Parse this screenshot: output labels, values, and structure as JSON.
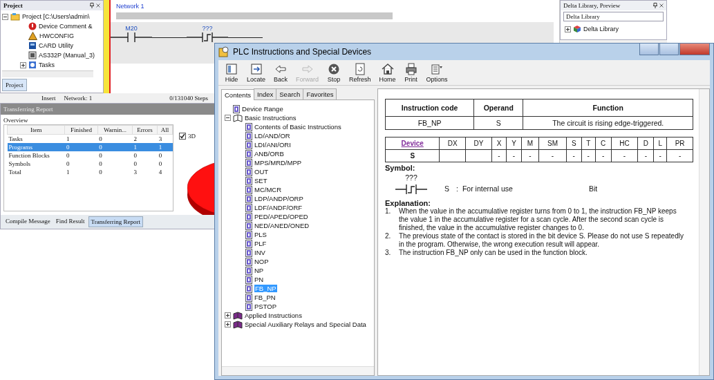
{
  "ide": {
    "project_panel": {
      "title": "Project",
      "tree": [
        {
          "label": "Project [C:\\Users\\admin\\",
          "kind": "project",
          "expanded": true,
          "children": [
            {
              "label": "Device Comment &",
              "kind": "comment"
            },
            {
              "label": "HWCONFIG",
              "kind": "config"
            },
            {
              "label": "CARD Utility",
              "kind": "card"
            },
            {
              "label": "AS332P  (Manual_3)",
              "kind": "cpu"
            },
            {
              "label": "Tasks",
              "kind": "tasks",
              "expanded": false
            }
          ]
        }
      ],
      "tab": "Project"
    },
    "ladder": {
      "network": "Network 1",
      "contacts": [
        {
          "kind": "normally-open",
          "label": "M20"
        },
        {
          "kind": "rising-edge",
          "label": "???"
        }
      ]
    },
    "library": {
      "title": "Delta Library, Preview",
      "dropdown": "Delta Library",
      "tree": [
        {
          "label": "Delta Library",
          "expanded": false
        }
      ]
    },
    "status_bar": [
      "Insert",
      "Network: 1",
      "0/131040 Steps"
    ],
    "report": {
      "title": "Transferring Report",
      "section": "Overview",
      "columns": [
        "Item",
        "Finished",
        "Warnin...",
        "Errors",
        "All"
      ],
      "rows": [
        {
          "cells": [
            "Tasks",
            "1",
            "0",
            "2",
            "3"
          ],
          "selected": false
        },
        {
          "cells": [
            "Programs",
            "0",
            "0",
            "1",
            "1"
          ],
          "selected": true
        },
        {
          "cells": [
            "Function Blocks",
            "0",
            "0",
            "0",
            "0"
          ],
          "selected": false
        },
        {
          "cells": [
            "Symbols",
            "0",
            "0",
            "0",
            "0"
          ],
          "selected": false
        },
        {
          "cells": [
            "Total",
            "1",
            "0",
            "3",
            "4"
          ],
          "selected": false
        }
      ],
      "checkbox": {
        "label": "3D",
        "checked": true
      },
      "tabs": [
        {
          "label": "Compile Message",
          "selected": false
        },
        {
          "label": "Find Result",
          "selected": false
        },
        {
          "label": "Transferring Report",
          "selected": true
        }
      ]
    }
  },
  "dialog": {
    "title": "PLC Instructions and Special Devices",
    "toolbar": [
      {
        "label": "Hide",
        "disabled": false
      },
      {
        "label": "Locate",
        "disabled": false
      },
      {
        "label": "Back",
        "disabled": false
      },
      {
        "label": "Forward",
        "disabled": true
      },
      {
        "label": "Stop",
        "disabled": false
      },
      {
        "label": "Refresh",
        "disabled": false
      },
      {
        "label": "Home",
        "disabled": false
      },
      {
        "label": "Print",
        "disabled": false
      },
      {
        "label": "Options",
        "disabled": false
      }
    ],
    "nav_tabs": [
      {
        "label": "Contents",
        "selected": true
      },
      {
        "label": "Index",
        "selected": false
      },
      {
        "label": "Search",
        "selected": false
      },
      {
        "label": "Favorites",
        "selected": false
      }
    ],
    "tree": [
      {
        "label": "Device Range",
        "kind": "page",
        "selected": false
      },
      {
        "label": "Basic Instructions",
        "kind": "book",
        "expanded": true,
        "selected": false,
        "children": [
          {
            "label": "Contents of Basic Instructions",
            "kind": "page",
            "selected": false
          },
          {
            "label": "LD/AND/OR",
            "kind": "page",
            "selected": false
          },
          {
            "label": "LDI/ANI/ORI",
            "kind": "page",
            "selected": false
          },
          {
            "label": "ANB/ORB",
            "kind": "page",
            "selected": false
          },
          {
            "label": "MPS/MRD/MPP",
            "kind": "page",
            "selected": false
          },
          {
            "label": "OUT",
            "kind": "page",
            "selected": false
          },
          {
            "label": "SET",
            "kind": "page",
            "selected": false
          },
          {
            "label": "MC/MCR",
            "kind": "page",
            "selected": false
          },
          {
            "label": "LDP/ANDP/ORP",
            "kind": "page",
            "selected": false
          },
          {
            "label": "LDF/ANDF/ORF",
            "kind": "page",
            "selected": false
          },
          {
            "label": "PED/APED/OPED",
            "kind": "page",
            "selected": false
          },
          {
            "label": "NED/ANED/ONED",
            "kind": "page",
            "selected": false
          },
          {
            "label": "PLS",
            "kind": "page",
            "selected": false
          },
          {
            "label": "PLF",
            "kind": "page",
            "selected": false
          },
          {
            "label": "INV",
            "kind": "page",
            "selected": false
          },
          {
            "label": "NOP",
            "kind": "page",
            "selected": false
          },
          {
            "label": "NP",
            "kind": "page",
            "selected": false
          },
          {
            "label": "PN",
            "kind": "page",
            "selected": false
          },
          {
            "label": "FB_NP",
            "kind": "page",
            "selected": true
          },
          {
            "label": "FB_PN",
            "kind": "page",
            "selected": false
          },
          {
            "label": "PSTOP",
            "kind": "page",
            "selected": false
          }
        ]
      },
      {
        "label": "Applied Instructions",
        "kind": "book",
        "expanded": false,
        "selected": false
      },
      {
        "label": "Special Auxiliary Relays and Special Data",
        "kind": "book",
        "expanded": false,
        "selected": false
      }
    ],
    "content": {
      "instruction_table": {
        "columns": [
          "Instruction code",
          "Operand",
          "Function"
        ],
        "row": [
          "FB_NP",
          "S",
          "The circuit is rising edge-triggered."
        ]
      },
      "device_table": [
        {
          "header": "Device",
          "value": "S"
        },
        {
          "header": "DX"
        },
        {
          "header": "DY"
        },
        {
          "header": "X",
          "value": "-"
        },
        {
          "header": "Y",
          "value": "-"
        },
        {
          "header": "M",
          "value": "-"
        },
        {
          "header": "SM",
          "value": "-"
        },
        {
          "header": "S",
          "value": "-"
        },
        {
          "header": "T",
          "value": "-"
        },
        {
          "header": "C",
          "value": "-"
        },
        {
          "header": "HC",
          "value": "-"
        },
        {
          "header": "D",
          "value": "-"
        },
        {
          "header": "L",
          "value": "-"
        },
        {
          "header": "PR",
          "value": "-"
        }
      ],
      "symbol_heading": "Symbol:",
      "symbol_label": "???",
      "operand": "S",
      "separator": ":",
      "operand_description": "For internal use",
      "operand_type": "Bit",
      "explanation_heading": "Explanation:",
      "explanation": [
        {
          "number": "1.",
          "text": "When the value in the accumulative register turns from 0 to 1, the instruction FB_NP keeps the value 1 in the accumulative register for a scan cycle. After the second scan cycle is finished, the value in the accumulative register changes to 0."
        },
        {
          "number": "2.",
          "text": "The previous state of the contact is stored in the bit device S. Please do not use S repeatedly in the program. Otherwise, the wrong execution result will appear."
        },
        {
          "number": "3.",
          "text": "The instruction FB_NP only can be used in the function block."
        }
      ]
    }
  }
}
